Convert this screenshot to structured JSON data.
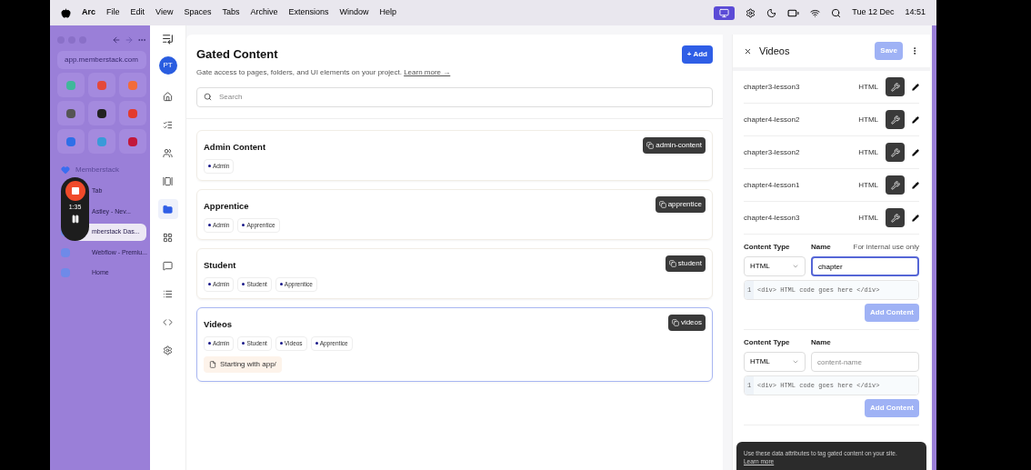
{
  "menu_bar": {
    "app": "Arc",
    "items": [
      "File",
      "Edit",
      "View",
      "Spaces",
      "Tabs",
      "Archive",
      "Extensions",
      "Window",
      "Help"
    ],
    "date": "Tue 12 Dec",
    "time": "14:51"
  },
  "browser_sidebar": {
    "url": "app.memberstack.com",
    "folder": "Memberstack",
    "tabs": [
      {
        "title": "Tab",
        "selected": false
      },
      {
        "title": "Astley - Nev...",
        "selected": false
      },
      {
        "title": "mberstack Das...",
        "selected": true
      },
      {
        "title": "Webflow - Premiu...",
        "selected": false
      },
      {
        "title": "Home",
        "selected": false
      }
    ]
  },
  "recorder": {
    "elapsed": "1:35"
  },
  "nav_rail": {
    "avatar": "PT",
    "items": [
      {
        "kind": "home",
        "selected": false
      },
      {
        "kind": "checklist",
        "selected": false
      },
      {
        "kind": "members",
        "selected": false
      },
      {
        "kind": "plans",
        "selected": false
      },
      {
        "kind": "folder",
        "selected": true
      },
      {
        "kind": "grid",
        "selected": false
      },
      {
        "kind": "chat",
        "selected": false
      },
      {
        "kind": "list",
        "selected": false
      },
      {
        "kind": "code",
        "selected": false
      },
      {
        "kind": "settings",
        "selected": false
      }
    ]
  },
  "main": {
    "title": "Gated Content",
    "subtitle": "Gate access to pages, folders, and UI elements on your project.",
    "link": "Learn more →",
    "add_button": "+ Add",
    "search_placeholder": "Search",
    "groups": [
      {
        "name": "Admin Content",
        "slug": "admin-content",
        "plans": [
          "Admin"
        ],
        "selected": false
      },
      {
        "name": "Apprentice",
        "slug": "apprentice",
        "plans": [
          "Admin",
          "Apprentice"
        ],
        "selected": false
      },
      {
        "name": "Student",
        "slug": "student",
        "plans": [
          "Admin",
          "Student",
          "Apprentice"
        ],
        "selected": false
      },
      {
        "name": "Videos",
        "slug": "videos",
        "plans": [
          "Admin",
          "Student",
          "Videos",
          "Apprentice"
        ],
        "rules": [
          "Starting with app/"
        ],
        "selected": true
      }
    ]
  },
  "panel": {
    "title": "Videos",
    "save": {
      "label": "Save",
      "disabled": true
    },
    "contents": [
      {
        "name": "chapter3-lesson3",
        "type": "HTML"
      },
      {
        "name": "chapter4-lesson2",
        "type": "HTML"
      },
      {
        "name": "chapter3-lesson2",
        "type": "HTML"
      },
      {
        "name": "chapter4-lesson1",
        "type": "HTML"
      },
      {
        "name": "chapter4-lesson3",
        "type": "HTML"
      }
    ],
    "forms": [
      {
        "type_label": "Content Type",
        "type": "HTML",
        "name_label": "Name",
        "hint": "For internal use only",
        "value": "chapter",
        "focused": true,
        "code_line": "1",
        "code": "<div> HTML code goes here </div>",
        "button": "Add Content",
        "disabled": true
      },
      {
        "type_label": "Content Type",
        "type": "HTML",
        "name_label": "Name",
        "placeholder": "content-name",
        "focused": false,
        "code_line": "1",
        "code": "<div> HTML code goes here </div>",
        "button": "Add Content",
        "disabled": true
      }
    ],
    "tooltip": "Use these data attributes to tag gated content on your site.",
    "tooltip_link": "Learn more"
  }
}
